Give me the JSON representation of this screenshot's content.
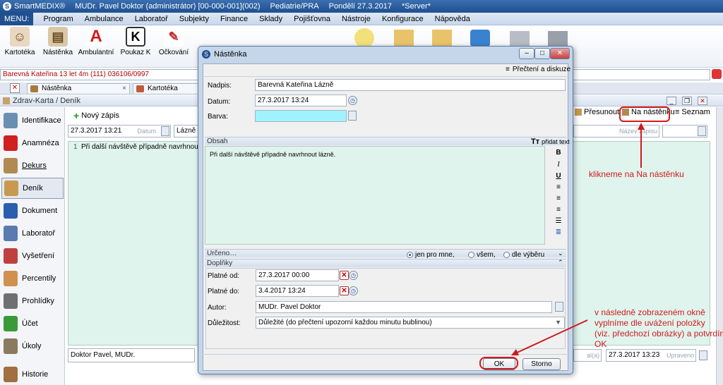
{
  "titlebar": {
    "app": "SmartMEDIX®",
    "user": "MUDr. Pavel Doktor (administrátor) [00-000-001](002)",
    "dept": "Pediatrie/PRA",
    "date": "Pondělí 27.3.2017",
    "server": "*Server*"
  },
  "menu": {
    "label": "MENU:",
    "items": [
      "Program",
      "Ambulance",
      "Laboratoř",
      "Subjekty",
      "Finance",
      "Sklady",
      "Pojišťovna",
      "Nástroje",
      "Konfigurace",
      "Nápověda"
    ]
  },
  "toolbar": {
    "items": [
      {
        "label": "Kartotéka",
        "icon": "people-icon"
      },
      {
        "label": "Nástěnka",
        "icon": "noticeboard-icon"
      },
      {
        "label": "Ambulantní",
        "icon": "letter-a-icon"
      },
      {
        "label": "Poukaz K",
        "icon": "letter-k-icon"
      },
      {
        "label": "Očkování",
        "icon": "syringe-icon"
      }
    ]
  },
  "patient": {
    "info": "Barevná Kateřina 13 let 4m (111)  036106/0997"
  },
  "tabs": [
    {
      "label": "Nástěnka"
    },
    {
      "label": "Kartotéka"
    }
  ],
  "breadcrumb": "Zdrav-Karta / Deník",
  "sidebar": {
    "items": [
      {
        "label": "Identifikace",
        "icon": "person-icon",
        "color": "#6a8fb0"
      },
      {
        "label": "Anamnéza",
        "icon": "red-cross-icon",
        "color": "#d02020"
      },
      {
        "label": "Dekurs",
        "icon": "folder-icon",
        "color": "#b08a50"
      },
      {
        "label": "Deník",
        "icon": "diary-icon",
        "color": "#c89a50"
      },
      {
        "label": "Dokument",
        "icon": "word-doc-icon",
        "color": "#2a5fb0"
      },
      {
        "label": "Laboratoř",
        "icon": "flask-icon",
        "color": "#5a7ab0"
      },
      {
        "label": "Vyšetření",
        "icon": "ecg-icon",
        "color": "#c04040"
      },
      {
        "label": "Percentily",
        "icon": "child-icon",
        "color": "#d09050"
      },
      {
        "label": "Prohlídky",
        "icon": "stethoscope-icon",
        "color": "#707070"
      },
      {
        "label": "Účet",
        "icon": "money-icon",
        "color": "#3a9a3a"
      },
      {
        "label": "Úkoly",
        "icon": "clipboard-icon",
        "color": "#8a7a60"
      },
      {
        "label": "Historie",
        "icon": "history-icon",
        "color": "#a07040"
      }
    ]
  },
  "main": {
    "new_entry": "Nový zápis",
    "date_value": "27.3.2017 13:21",
    "date_placeholder": "Datum",
    "title_value": "Lázně",
    "note_line_no": "1",
    "note_text": "Při další návštěvě případně navrhnout lázně.",
    "title_placeholder": "Název zápisu",
    "move_btn": "Přesunout",
    "board_btn": "Na nástěnku",
    "list_btn": "Seznam",
    "author_value": "Doktor Pavel, MUDr.",
    "bottom_date": "27.3.2017 13:23",
    "bottom_date_ph": "Upraveno",
    "bottom_left_ph": "al(a)"
  },
  "annotations": {
    "click_board": "klikneme na Na nástěnku",
    "fill_ok_1": "v následně zobrazeném okně",
    "fill_ok_2": "vyplníme dle uvážení položky",
    "fill_ok_3": "(viz. předchozí obrázky) a potvrdíme",
    "fill_ok_4": "OK",
    "color": "#d01a1a"
  },
  "dialog": {
    "title": "Nástěnka",
    "read_discuss": "Přečtení a diskuze",
    "heading_label": "Nadpis:",
    "heading_value": "Barevná Kateřina Lázně",
    "date_label": "Datum:",
    "date_value": "27.3.2017 13:24",
    "color_label": "Barva:",
    "color_value": "#9ff3ff",
    "content_section": "Obsah",
    "add_text": "přidat text",
    "content_text": "Při další návštěvě případně navrhnout lázně.",
    "intended_section": "Určeno…",
    "radio_me": "jen pro mne,",
    "radio_all": "všem,",
    "radio_select": "dle výběru",
    "extras_section": "Doplňky",
    "valid_from_label": "Platné od:",
    "valid_from_value": "27.3.2017 00:00",
    "valid_to_label": "Platné do:",
    "valid_to_value": "3.4.2017 13:24",
    "author_label": "Autor:",
    "author_value": "MUDr. Pavel Doktor",
    "importance_label": "Důležitost:",
    "importance_value": "Důležité (do přečtení upozorní každou minutu bublinou)",
    "ok": "OK",
    "cancel": "Storno"
  }
}
